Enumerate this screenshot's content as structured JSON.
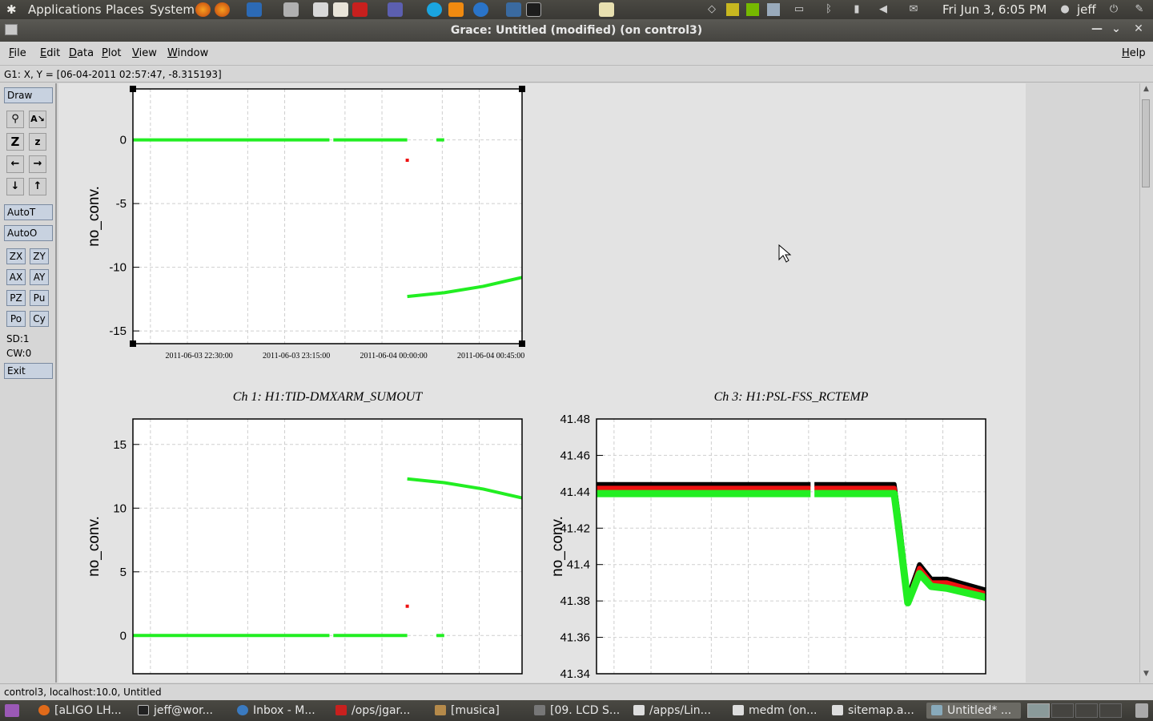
{
  "top_panel": {
    "menus": [
      "Applications",
      "Places",
      "System"
    ],
    "clock": "Fri Jun 3,  6:05 PM",
    "user": "jeff"
  },
  "window": {
    "title": "Grace: Untitled (modified) (on control3)"
  },
  "menubar": {
    "items": [
      "File",
      "Edit",
      "Data",
      "Plot",
      "View",
      "Window"
    ],
    "help": "Help"
  },
  "locator": "G1: X, Y = [06-04-2011 02:57:47, -8.315193]",
  "toolbar": {
    "draw": "Draw",
    "icons": [
      "zoom-icon",
      "text-icon",
      "zoom-out-icon",
      "zoom-in-icon",
      "arrow-left-icon",
      "arrow-right-icon",
      "arrow-down-icon",
      "arrow-up-icon"
    ],
    "autot": "AutoT",
    "autoo": "AutoO",
    "small_buttons": [
      "ZX",
      "ZY",
      "AX",
      "AY",
      "PZ",
      "Pu",
      "Po",
      "Cy"
    ],
    "sd": "SD:1",
    "cw": "CW:0",
    "exit": "Exit"
  },
  "statusline": "control3, localhost:10.0, Untitled",
  "taskbar": [
    "[aLIGO LH...",
    "jeff@wor...",
    "Inbox - M...",
    "/ops/jgar...",
    "[musica]",
    "[09. LCD S...",
    "/apps/Lin...",
    "medm (on...",
    "sitemap.a...",
    "Untitled* ..."
  ],
  "colors": {
    "series_green": "#22ee22",
    "series_red": "#ee1111",
    "series_black": "#000000"
  },
  "chart_data": [
    {
      "type": "line",
      "title": "",
      "xlabel": "",
      "ylabel": "no_conv.",
      "ylim": [
        -16,
        4
      ],
      "yticks": [
        "0",
        "-5",
        "-10",
        "-15"
      ],
      "xticks": [
        "2011-06-03 22:30:00",
        "2011-06-03 23:15:00",
        "2011-06-04 00:00:00",
        "2011-06-04 00:45:00"
      ],
      "series": [
        {
          "color": "green",
          "x": [
            0,
            50.5,
            51.5,
            70.5,
            78,
            80
          ],
          "y": [
            0,
            0,
            0,
            0,
            0,
            0
          ]
        },
        {
          "color": "red",
          "x": [
            70.5
          ],
          "y": [
            -1.6
          ]
        },
        {
          "color": "green",
          "x": [
            70.5,
            80,
            90,
            100
          ],
          "y": [
            -12.3,
            -12.0,
            -11.5,
            -10.8
          ]
        }
      ]
    },
    {
      "type": "line",
      "title": "Ch 1: H1:TID-DMXARM_SUMOUT",
      "xlabel": "",
      "ylabel": "no_conv.",
      "ylim": [
        -3,
        17
      ],
      "yticks": [
        "15",
        "10",
        "5",
        "0"
      ],
      "series": [
        {
          "color": "green",
          "x": [
            0,
            50.5,
            51.5,
            70.5,
            78,
            80
          ],
          "y": [
            0,
            0,
            0,
            0,
            0,
            0
          ]
        },
        {
          "color": "red",
          "x": [
            70.5
          ],
          "y": [
            2.3
          ]
        },
        {
          "color": "green",
          "x": [
            70.5,
            80,
            90,
            100
          ],
          "y": [
            12.3,
            12.0,
            11.5,
            10.8
          ]
        }
      ]
    },
    {
      "type": "line",
      "title": "Ch 3: H1:PSL-FSS_RCTEMP",
      "xlabel": "",
      "ylabel": "no_conv.",
      "ylim": [
        41.34,
        41.48
      ],
      "yticks": [
        "41.48",
        "41.46",
        "41.44",
        "41.42",
        "41.4",
        "41.38",
        "41.36",
        "41.34"
      ],
      "series": [
        {
          "color": "black",
          "x": [
            0,
            55,
            56,
            76.5,
            78,
            80,
            83,
            86,
            90,
            100
          ],
          "y": [
            41.444,
            41.444,
            41.444,
            41.444,
            41.42,
            41.382,
            41.4,
            41.392,
            41.392,
            41.386
          ]
        },
        {
          "color": "red",
          "x": [
            0,
            55,
            56,
            76.5,
            78,
            80,
            83,
            86,
            90,
            100
          ],
          "y": [
            41.442,
            41.442,
            41.442,
            41.442,
            41.418,
            41.38,
            41.398,
            41.39,
            41.39,
            41.384
          ]
        },
        {
          "color": "green",
          "x": [
            0,
            55,
            56,
            76.5,
            78,
            80,
            83,
            86,
            90,
            100
          ],
          "y": [
            41.439,
            41.439,
            41.439,
            41.439,
            41.414,
            41.379,
            41.395,
            41.388,
            41.387,
            41.382
          ]
        }
      ]
    }
  ]
}
